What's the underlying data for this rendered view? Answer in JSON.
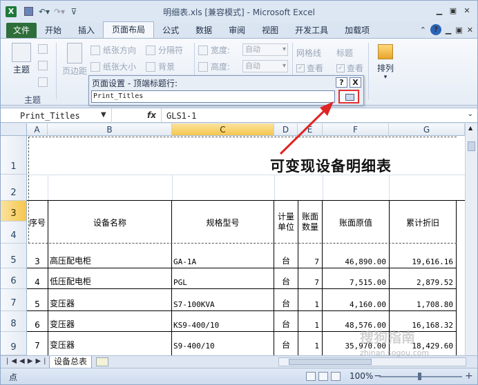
{
  "window": {
    "title": "明细表.xls  [兼容模式] - Microsoft Excel",
    "app_icon": "X",
    "qat_icons": [
      "save-icon",
      "undo-icon",
      "redo-icon",
      "customize-icon"
    ],
    "controls": [
      "minimize-icon",
      "restore-icon",
      "close-icon"
    ]
  },
  "tabs": [
    "文件",
    "开始",
    "插入",
    "页面布局",
    "公式",
    "数据",
    "审阅",
    "视图",
    "开发工具",
    "加载项"
  ],
  "active_tab": "页面布局",
  "ribbon": {
    "theme_label": "主题",
    "theme_group": "主题",
    "margins_label": "页边距",
    "orientation_label": "纸张方向",
    "size_label": "纸张大小",
    "breaks_label": "分隔符",
    "background_label": "背景",
    "width_label": "宽度:",
    "height_label": "高度:",
    "width_value": "自动",
    "height_value": "自动",
    "gridlines_label": "网格线",
    "headings_label": "标题",
    "view_label": "查看",
    "view_label2": "查看",
    "arrange_label": "排列"
  },
  "page_setup_dialog": {
    "title": "页面设置 - 顶端标题行:",
    "value": "Print_Titles",
    "help": "?",
    "close": "X"
  },
  "formula_bar": {
    "name_box": "Print_Titles",
    "fx": "fx",
    "content": "GLS1-1"
  },
  "columns": [
    "A",
    "B",
    "C",
    "D",
    "E",
    "F",
    "G"
  ],
  "selected_column": "C",
  "rows": [
    "1",
    "2",
    "3",
    "4",
    "5",
    "6",
    "7",
    "8",
    "9"
  ],
  "selected_row": "3",
  "annotation": "可变现设备明细表",
  "table": {
    "headers": {
      "seq": "序号",
      "name": "设备名称",
      "model": "规格型号",
      "unit": "计量\n单位",
      "qty": "账面\n数量",
      "orig": "账面原值",
      "depr": "累计折旧"
    },
    "rows": [
      {
        "seq": "3",
        "name": "高压配电柜",
        "model": "GA-1A",
        "unit": "台",
        "qty": "7",
        "orig": "46,890.00",
        "depr": "19,616.16"
      },
      {
        "seq": "4",
        "name": "低压配电柜",
        "model": "PGL",
        "unit": "台",
        "qty": "7",
        "orig": "7,515.00",
        "depr": "2,879.52"
      },
      {
        "seq": "5",
        "name": "变压器",
        "model": "S7-100KVA",
        "unit": "台",
        "qty": "1",
        "orig": "4,160.00",
        "depr": "1,708.80"
      },
      {
        "seq": "6",
        "name": "变压器",
        "model": "KS9-400/10",
        "unit": "台",
        "qty": "1",
        "orig": "48,576.00",
        "depr": "16,168.32"
      },
      {
        "seq": "7",
        "name": "变压器",
        "model": "S9-400/10",
        "unit": "台",
        "qty": "1",
        "orig": "35,970.00",
        "depr": "18,429.60"
      }
    ]
  },
  "sheet_tab": "设备总表",
  "status": {
    "ready": "点",
    "zoom": "100%"
  },
  "watermark": "搜狗指南",
  "watermark_url": "zhinan.sogou.com"
}
